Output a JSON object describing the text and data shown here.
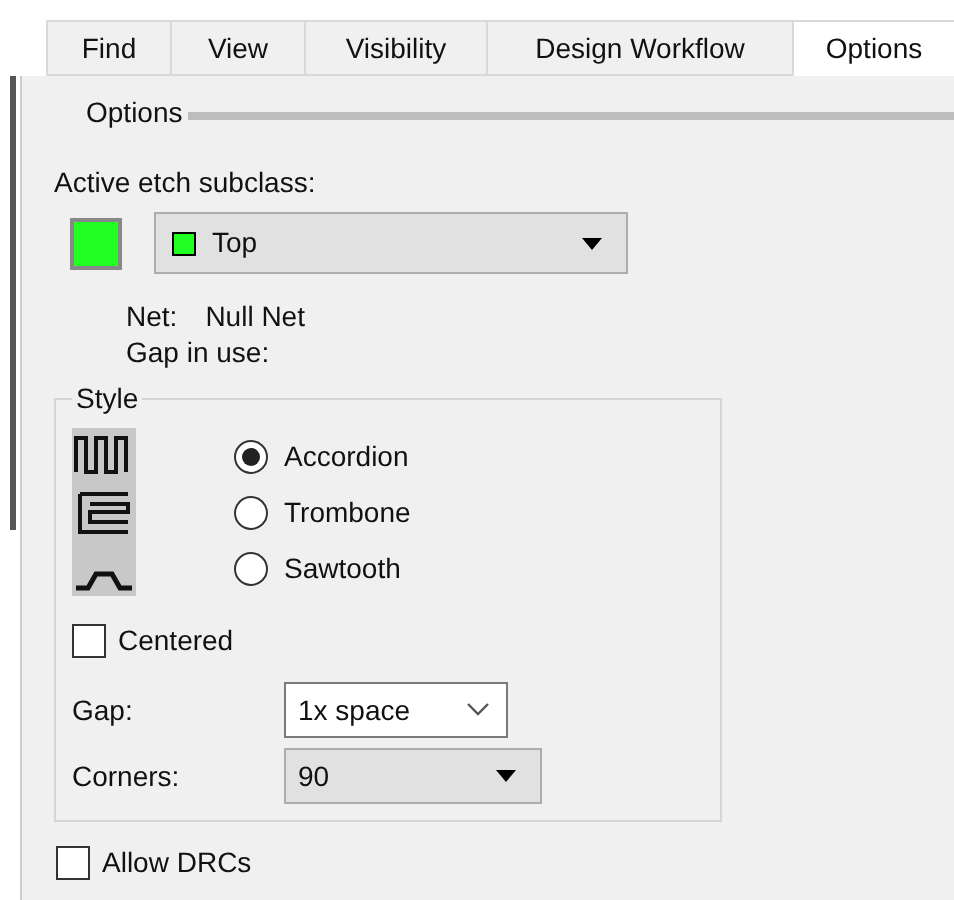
{
  "tabs": [
    {
      "label": "Find",
      "selected": false
    },
    {
      "label": "View",
      "selected": false
    },
    {
      "label": "Visibility",
      "selected": false
    },
    {
      "label": "Design Workflow",
      "selected": false
    },
    {
      "label": "Options",
      "selected": true
    }
  ],
  "section_title": "Options",
  "active_etch": {
    "label": "Active etch subclass:",
    "color": "#22ff22",
    "value": "Top"
  },
  "net": {
    "label": "Net:",
    "value": "Null Net"
  },
  "gap_in_use": {
    "label": "Gap in use:"
  },
  "style": {
    "title": "Style",
    "options": [
      {
        "kind": "accordion",
        "label": "Accordion",
        "selected": true
      },
      {
        "kind": "trombone",
        "label": "Trombone",
        "selected": false
      },
      {
        "kind": "sawtooth",
        "label": "Sawtooth",
        "selected": false
      }
    ],
    "centered": {
      "label": "Centered",
      "checked": false
    },
    "gap": {
      "label": "Gap:",
      "value": "1x space"
    },
    "corners": {
      "label": "Corners:",
      "value": "90"
    }
  },
  "allow_drcs": {
    "label": "Allow DRCs",
    "checked": false
  }
}
